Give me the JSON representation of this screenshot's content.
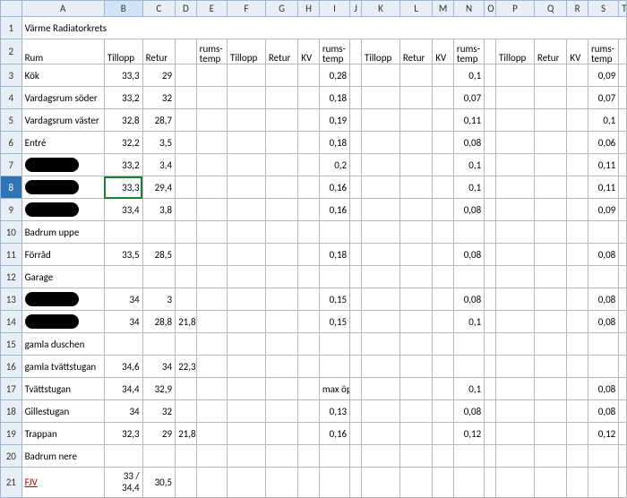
{
  "columns": [
    "A",
    "B",
    "C",
    "D",
    "E",
    "F",
    "G",
    "H",
    "I",
    "J",
    "K",
    "L",
    "M",
    "N",
    "O",
    "P",
    "Q",
    "R",
    "S",
    "T"
  ],
  "title": "Värme Radiatorkrets",
  "headers": {
    "rum": "Rum",
    "tillopp": "Tillopp",
    "retur": "Retur",
    "kv": "KV",
    "rumstemp": "rums-temp"
  },
  "selected_cell": "B8",
  "rows": [
    {
      "n": 3,
      "rum": "Kök",
      "b": "33,3",
      "c": "29",
      "i": "0,28",
      "n2": "0,1",
      "s": "0,09"
    },
    {
      "n": 4,
      "rum": "Vardagsrum söder",
      "b": "33,2",
      "c": "32",
      "i": "0,18",
      "n2": "0,07",
      "s": "0,07"
    },
    {
      "n": 5,
      "rum": "Vardagsrum väster",
      "b": "32,8",
      "c": "28,7",
      "i": "0,19",
      "n2": "0,11",
      "s": "0,1"
    },
    {
      "n": 6,
      "rum": "Entré",
      "b": "32,2",
      "c": "3,5",
      "i": "0,18",
      "n2": "0,08",
      "s": "0,06"
    },
    {
      "n": 7,
      "rum": "[REDACTED]",
      "b": "33,2",
      "c": "3,4",
      "i": "0,2",
      "n2": "0,1",
      "s": "0,11"
    },
    {
      "n": 8,
      "rum": "[REDACTED]",
      "b": "33,3",
      "c": "29,4",
      "i": "0,16",
      "n2": "0,1",
      "s": "0,11",
      "selected": true
    },
    {
      "n": 9,
      "rum": "[REDACTED]",
      "b": "33,4",
      "c": "3,8",
      "i": "0,16",
      "n2": "0,08",
      "s": "0,09"
    },
    {
      "n": 10,
      "rum": "Badrum uppe"
    },
    {
      "n": 11,
      "rum": "Förråd",
      "b": "33,5",
      "c": "28,5",
      "i": "0,18",
      "n2": "0,08",
      "s": "0,08"
    },
    {
      "n": 12,
      "rum": "Garage"
    },
    {
      "n": 13,
      "rum": "[REDACTED]",
      "b": "34",
      "c": "3",
      "i": "0,15",
      "n2": "0,08",
      "s": "0,08"
    },
    {
      "n": 14,
      "rum": "[REDACTED]",
      "b": "34",
      "c": "28,8",
      "d": "21,8",
      "i": "0,15",
      "n2": "0,1",
      "s": "0,08"
    },
    {
      "n": 15,
      "rum": "gamla duschen"
    },
    {
      "n": 16,
      "rum": "gamla tvättstugan",
      "b": "34,6",
      "c": "34",
      "d": "22,3"
    },
    {
      "n": 17,
      "rum": "Tvättstugan",
      "b": "34,4",
      "c": "32,9",
      "itxt": "max öppen",
      "n2": "0,1",
      "s": "0,08"
    },
    {
      "n": 18,
      "rum": "Gillestugan",
      "b": "34",
      "c": "32",
      "i": "0,13",
      "n2": "0,08",
      "s": "0,08"
    },
    {
      "n": 19,
      "rum": "Trappan",
      "b": "32,3",
      "c": "29",
      "d": "21,8",
      "i": "0,16",
      "n2": "0,12",
      "s": "0,12"
    },
    {
      "n": 20,
      "rum": "Badrum nere"
    },
    {
      "n": 21,
      "rum": "FJV",
      "rumlink": true,
      "b": "33 / 34,4",
      "c": "30,5",
      "tall": true
    }
  ]
}
